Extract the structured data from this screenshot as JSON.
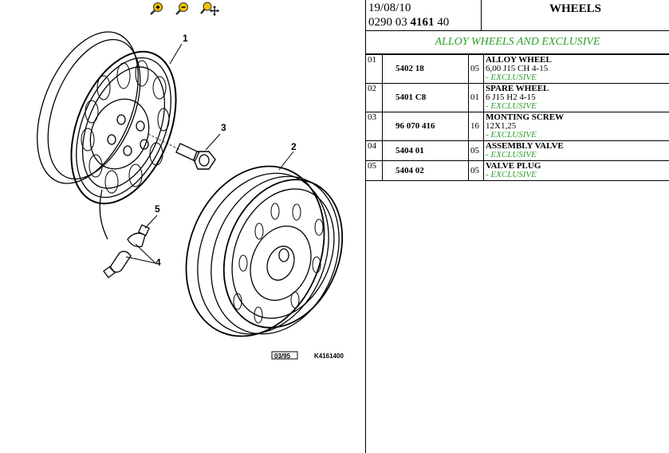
{
  "toolbar": {
    "zoom_in_icon": "zoom-in-icon",
    "zoom_out_icon": "zoom-out-icon",
    "zoom_pan_icon": "zoom-pan-icon"
  },
  "diagram": {
    "callouts": [
      "1",
      "2",
      "3",
      "4",
      "5"
    ],
    "date_code": "03/95",
    "ref_code": "K4161400"
  },
  "header": {
    "date": "19/08/10",
    "ref_prefix": "0290 03 ",
    "ref_bold": "4161",
    "ref_suffix": " 40",
    "title": "WHEELS",
    "subtitle": "ALLOY WHEELS AND EXCLUSIVE"
  },
  "parts": [
    {
      "num": "01",
      "part": "5402 18",
      "qty": "05",
      "name": "ALLOY WHEEL",
      "detail": "6,00 J15 CH 4-15",
      "option": "- EXCLUSIVE"
    },
    {
      "num": "02",
      "part": "5401 C8",
      "qty": "01",
      "name": "SPARE WHEEL",
      "detail": "6 J15 H2 4-15",
      "option": "- EXCLUSIVE"
    },
    {
      "num": "03",
      "part": "96 070 416",
      "qty": "16",
      "name": "MONTING SCREW",
      "detail": "12X1,25",
      "option": "- EXCLUSIVE"
    },
    {
      "num": "04",
      "part": "5404 01",
      "qty": "05",
      "name": "ASSEMBLY VALVE",
      "detail": "",
      "option": "- EXCLUSIVE"
    },
    {
      "num": "05",
      "part": "5404 02",
      "qty": "05",
      "name": "VALVE PLUG",
      "detail": "",
      "option": "- EXCLUSIVE"
    }
  ],
  "colors": {
    "accent_green": "#2ca02c",
    "toolbar_yellow": "#f2c200"
  }
}
